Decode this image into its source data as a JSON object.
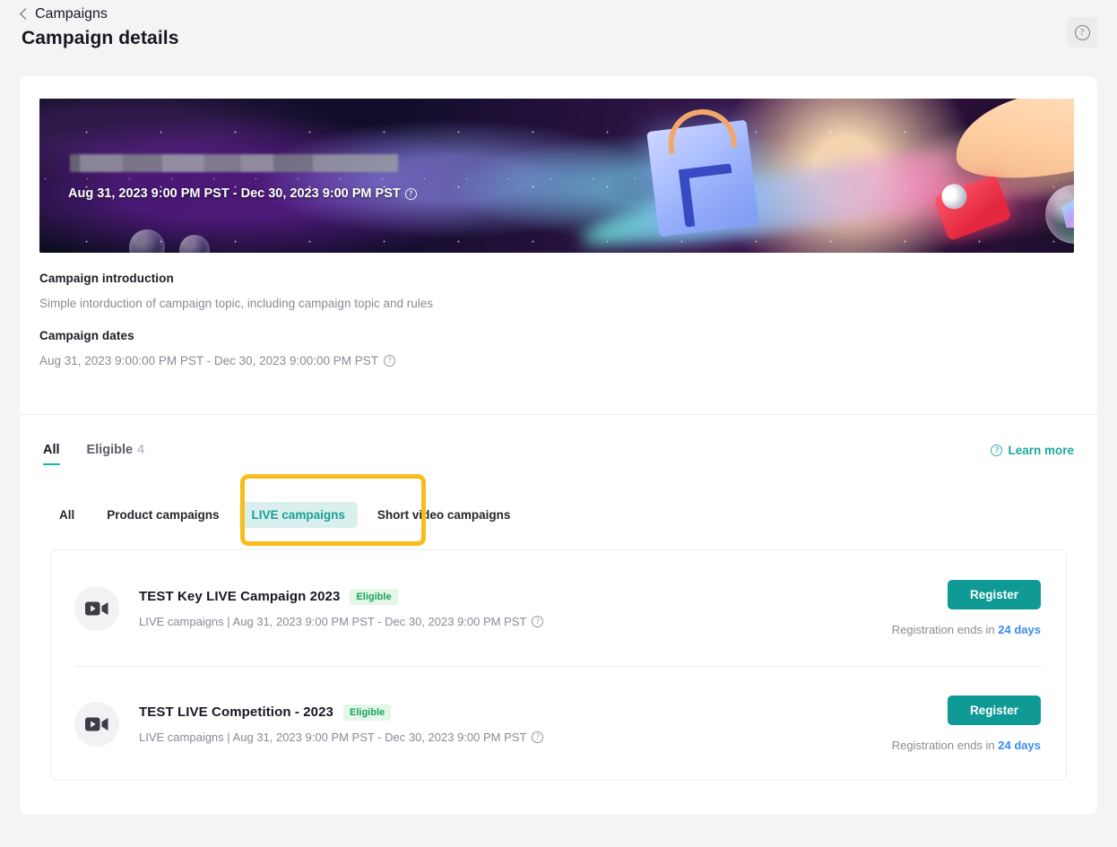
{
  "header": {
    "breadcrumb": "Campaigns",
    "back_icon": "chevron-left-icon",
    "title": "Campaign details",
    "help_icon": "question-circle-icon"
  },
  "banner": {
    "redacted_title": "",
    "dates": "Aug 31, 2023 9:00 PM PST - Dec 30, 2023 9:00 PM PST",
    "dates_info_icon": "question-circle-icon",
    "artwork": "tiktok-shopping-bag-illustration"
  },
  "details": {
    "introduction_label": "Campaign introduction",
    "introduction_value": "Simple intorduction of campaign topic, including campaign topic and rules",
    "dates_label": "Campaign dates",
    "dates_value": "Aug 31, 2023 9:00:00 PM PST - Dec 30, 2023 9:00:00 PM PST",
    "dates_info_icon": "question-circle-icon"
  },
  "filters": {
    "top_tabs": [
      {
        "label": "All",
        "count": "",
        "active": true
      },
      {
        "label": "Eligible",
        "count": "4",
        "active": false
      }
    ],
    "learn_more": "Learn more",
    "learn_more_icon": "question-circle-icon",
    "sub_tabs": [
      {
        "label": "All",
        "selected": false
      },
      {
        "label": "Product campaigns",
        "selected": false
      },
      {
        "label": "LIVE campaigns",
        "selected": true
      },
      {
        "label": "Short video campaigns",
        "selected": false
      }
    ]
  },
  "campaigns": [
    {
      "icon": "video-camera-icon",
      "title": "TEST Key LIVE Campaign 2023",
      "badge": "Eligible",
      "subtitle": "LIVE campaigns | Aug 31, 2023 9:00 PM PST - Dec 30, 2023 9:00 PM PST",
      "subtitle_info_icon": "question-circle-icon",
      "action_label": "Register",
      "registration_prefix": "Registration ends in",
      "registration_days": "24 days"
    },
    {
      "icon": "video-camera-icon",
      "title": "TEST LIVE Competition - 2023",
      "badge": "Eligible",
      "subtitle": "LIVE campaigns | Aug 31, 2023 9:00 PM PST - Dec 30, 2023 9:00 PM PST",
      "subtitle_info_icon": "question-circle-icon",
      "action_label": "Register",
      "registration_prefix": "Registration ends in",
      "registration_days": "24 days"
    }
  ],
  "colors": {
    "page_bg": "#f4f4f5",
    "accent_teal": "#0f9a96",
    "tab_underline": "#16b6a6",
    "pill_selected_bg": "#daf0ee",
    "badge_green": "#19a35a",
    "badge_bg": "#e3f7e9",
    "link_blue": "#3a8cf0",
    "highlight_border": "#f9bd1b"
  }
}
